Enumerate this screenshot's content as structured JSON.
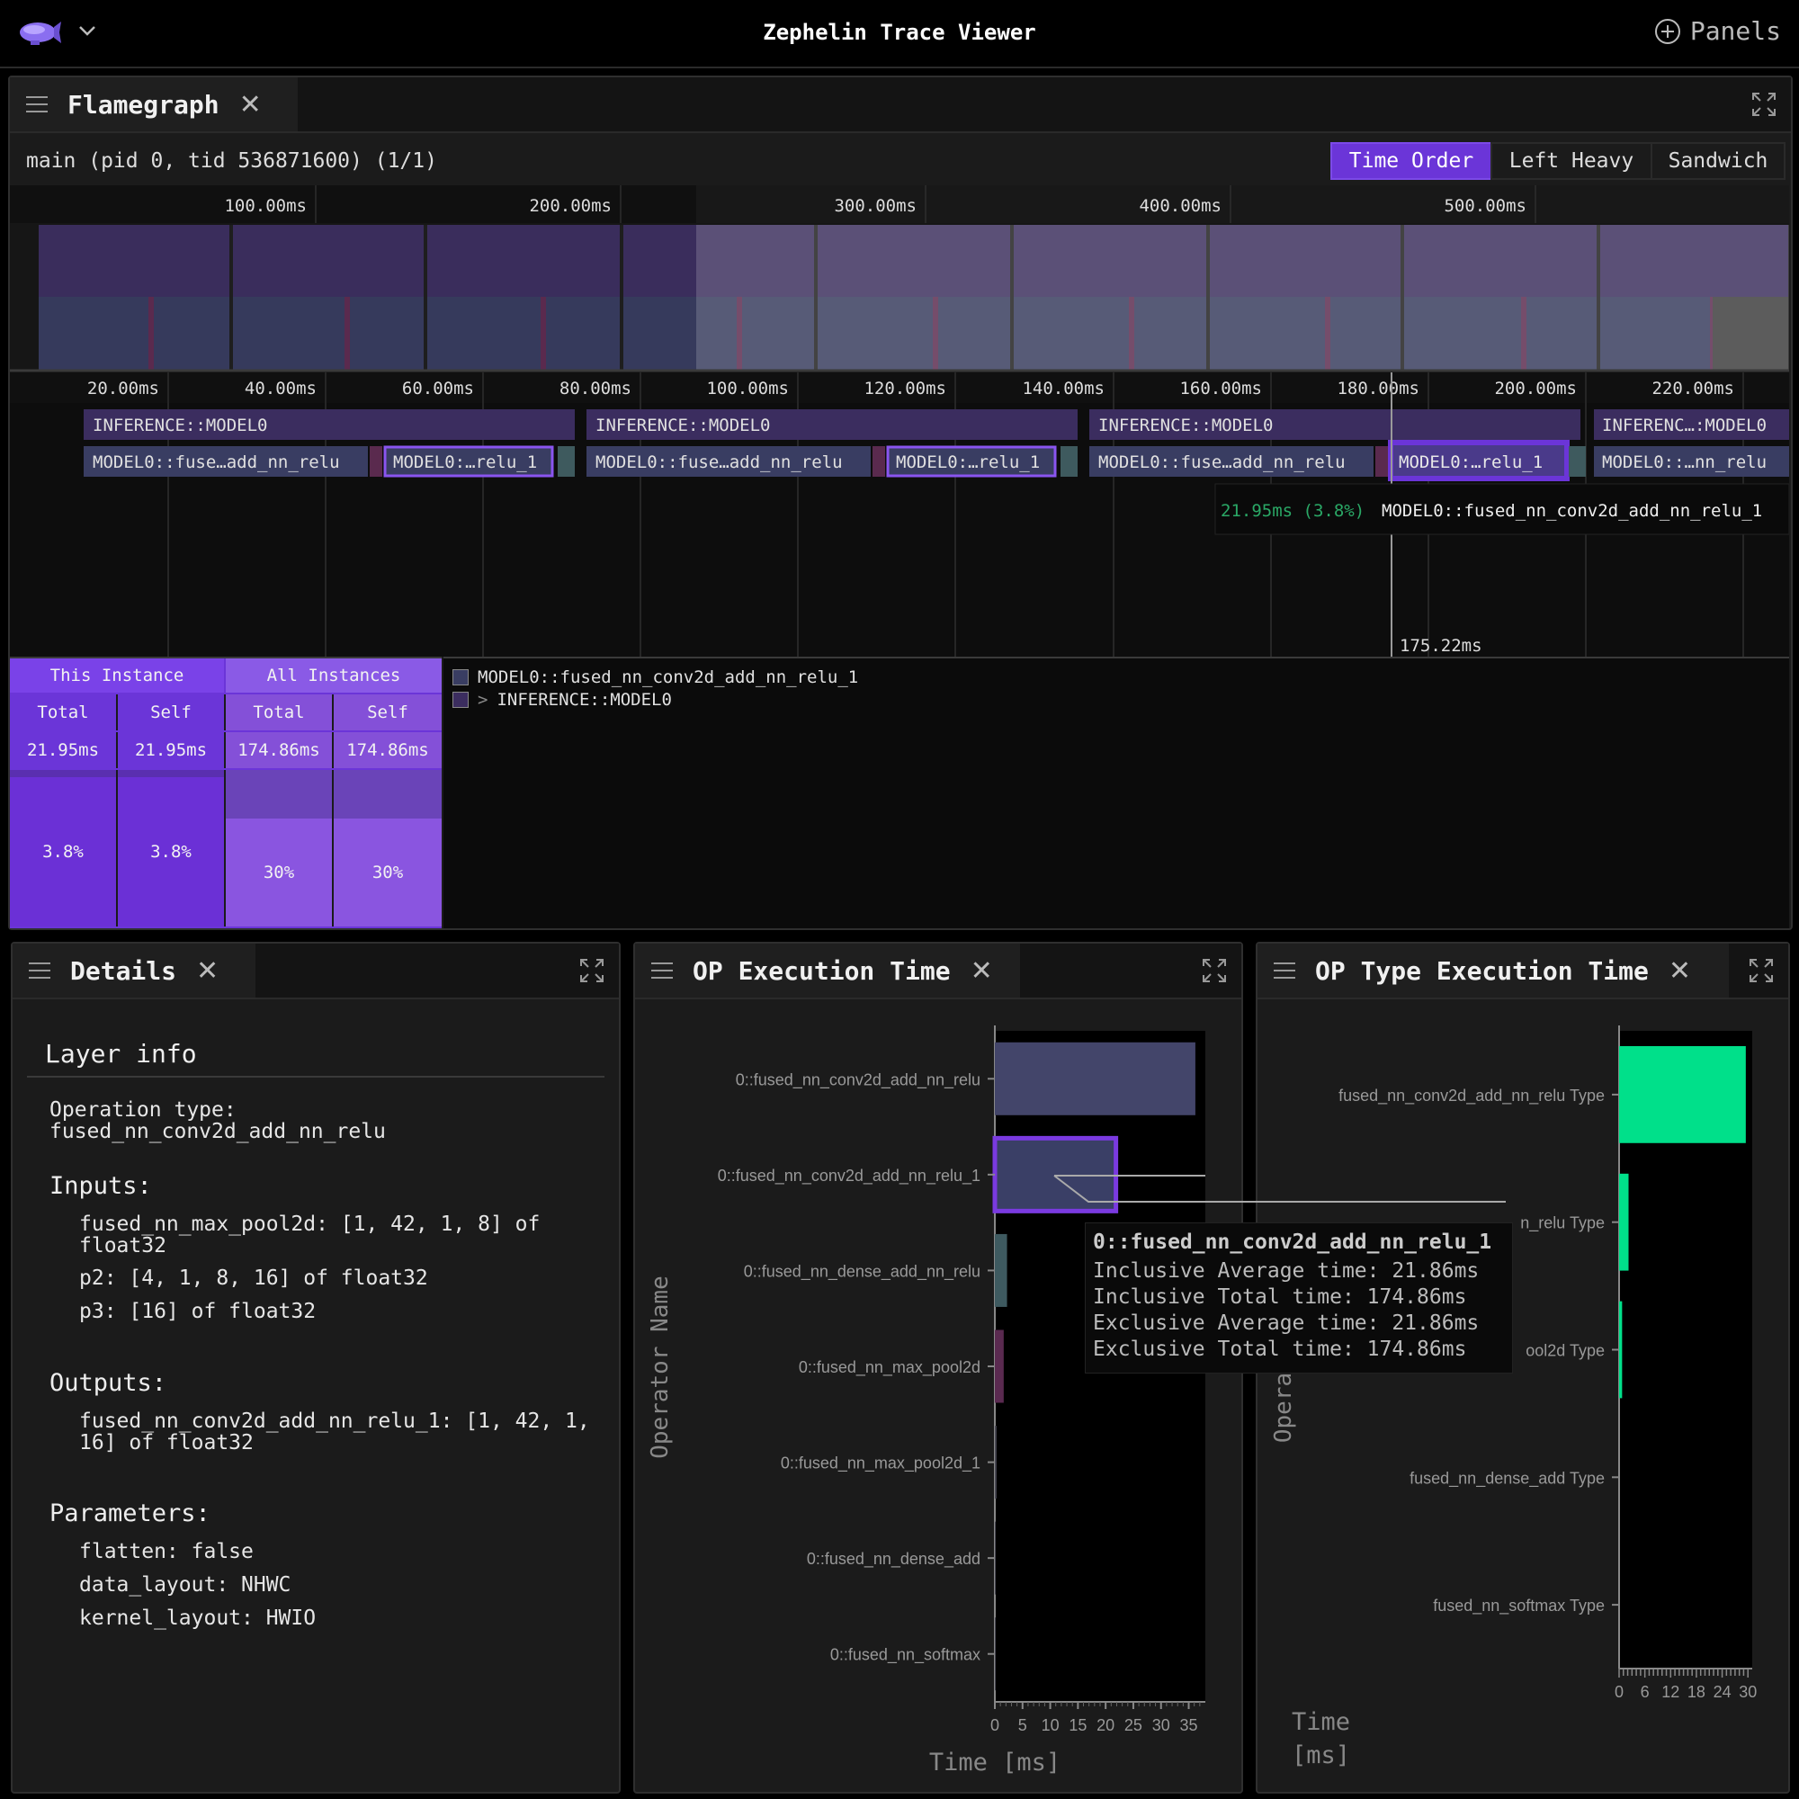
{
  "app": {
    "title": "Zephelin Trace Viewer",
    "panels_label": "Panels"
  },
  "flamegraph": {
    "tab_title": "Flamegraph",
    "thread_label": "main (pid 0, tid 536871600) (1/1)",
    "views": [
      "Time Order",
      "Left Heavy",
      "Sandwich"
    ],
    "active_view": "Time Order",
    "overview_ticks": [
      "100.00ms",
      "200.00ms",
      "300.00ms",
      "400.00ms",
      "500.00ms"
    ],
    "detail_ticks": [
      "20.00ms",
      "40.00ms",
      "60.00ms",
      "80.00ms",
      "100.00ms",
      "120.00ms",
      "140.00ms",
      "160.00ms",
      "180.00ms",
      "200.00ms",
      "220.00ms"
    ],
    "frames": {
      "f1_top": "INFERENCE::MODEL0",
      "f1_a": "MODEL0::fuse…add_nn_relu",
      "f1_b": "MODEL0:…relu_1",
      "f2_top": "INFERENCE::MODEL0",
      "f2_a": "MODEL0::fuse…add_nn_relu",
      "f2_b": "MODEL0:…relu_1",
      "f3_top": "INFERENCE::MODEL0",
      "f3_a": "MODEL0::fuse…add_nn_relu",
      "f3_b": "MODEL0:…relu_1",
      "f4_top": "INFERENC…:MODEL0",
      "f4_a": "MODEL0::…nn_relu"
    },
    "hover_tooltip": {
      "time": "21.95ms (3.8%)",
      "name": "MODEL0::fused_nn_conv2d_add_nn_relu_1"
    },
    "cursor_time": "175.22ms",
    "stats": {
      "this_instance": "This Instance",
      "all_instances": "All Instances",
      "total_label": "Total",
      "self_label": "Self",
      "this_total": "21.95ms",
      "this_self": "21.95ms",
      "all_total": "174.86ms",
      "all_self": "174.86ms",
      "this_total_pct": "3.8%",
      "this_self_pct": "3.8%",
      "all_total_pct": "30%",
      "all_self_pct": "30%"
    },
    "stack": [
      "MODEL0::fused_nn_conv2d_add_nn_relu_1",
      "INFERENCE::MODEL0"
    ],
    "stack_arrow": ">"
  },
  "details": {
    "tab_title": "Details",
    "heading": "Layer info",
    "operation_type_label": "Operation type:",
    "operation_type": "fused_nn_conv2d_add_nn_relu",
    "inputs_label": "Inputs:",
    "inputs": [
      "fused_nn_max_pool2d: [1, 42, 1, 8] of float32",
      "p2: [4, 1, 8, 16] of float32",
      "p3: [16] of float32"
    ],
    "outputs_label": "Outputs:",
    "outputs": [
      "fused_nn_conv2d_add_nn_relu_1: [1, 42, 1, 16] of float32"
    ],
    "parameters_label": "Parameters:",
    "parameters": [
      "flatten: false",
      "data_layout: NHWC",
      "kernel_layout: HWIO"
    ]
  },
  "op_exec": {
    "tab_title": "OP Execution Time",
    "tooltip": {
      "title": "0::fused_nn_conv2d_add_nn_relu_1",
      "lines": [
        "Inclusive Average time: 21.86ms",
        "Inclusive Total time: 174.86ms",
        "Exclusive Average time: 21.86ms",
        "Exclusive Total time: 174.86ms"
      ]
    },
    "chart_data": {
      "type": "bar",
      "orientation": "horizontal",
      "categories": [
        "0::fused_nn_conv2d_add_nn_relu",
        "0::fused_nn_conv2d_add_nn_relu_1",
        "0::fused_nn_dense_add_nn_relu",
        "0::fused_nn_max_pool2d",
        "0::fused_nn_max_pool2d_1",
        "0::fused_nn_dense_add",
        "0::fused_nn_softmax"
      ],
      "values": [
        36.2,
        21.86,
        2.2,
        1.6,
        0.3,
        0.1,
        0.1
      ],
      "bar_colors": [
        "#43456a",
        "#3a3f66",
        "#3e5a60",
        "#5a2a50",
        "#4a4a55",
        "#4a4a55",
        "#4a4a55"
      ],
      "xlim": [
        0,
        38
      ],
      "xticks": [
        "0",
        "5",
        "10",
        "15",
        "20",
        "25",
        "30",
        "35"
      ],
      "xlabel": "Time [ms]",
      "ylabel": "Operator Name"
    }
  },
  "op_type_exec": {
    "tab_title": "OP Type Execution Time",
    "chart_data": {
      "type": "bar",
      "orientation": "horizontal",
      "categories": [
        "fused_nn_conv2d_add_nn_relu Type",
        "fused_nn_conv2d_add_nn_relu_1 Type",
        "fused_nn_max_pool2d Type",
        "fused_nn_dense_add Type",
        "fused_nn_softmax Type"
      ],
      "visible_labels": [
        "fused_nn_conv2d_add_nn_relu Type",
        "n_relu Type",
        "ool2d Type",
        "fused_nn_dense_add Type",
        "fused_nn_softmax Type"
      ],
      "values": [
        29.5,
        2.2,
        0.7,
        0,
        0
      ],
      "bar_color": "#00e08a",
      "xlim": [
        0,
        31
      ],
      "xticks": [
        "0",
        "6",
        "12",
        "18",
        "24",
        "30"
      ],
      "xlabel": "Time [ms]",
      "ylabel_fragment": "Opera"
    }
  }
}
